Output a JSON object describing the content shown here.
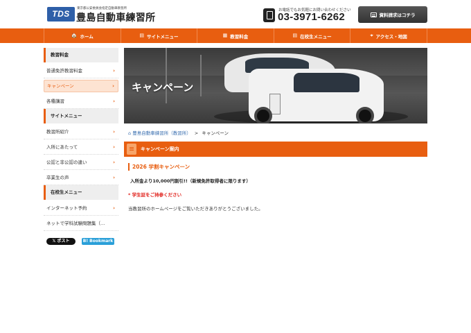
{
  "header": {
    "logo_badge": "TDS",
    "logo_subtitle": "東京都公安委員会指定自動車教習所",
    "logo_title": "豊島自動車練習所",
    "phone_note": "お電話でもお気軽にお問い合わせください",
    "phone_number": "03-3971-6262",
    "request_button": "資料請求はコチラ"
  },
  "nav": {
    "items": [
      {
        "icon": "🏠",
        "label": "ホーム"
      },
      {
        "icon": "▤",
        "label": "サイトメニュー"
      },
      {
        "icon": "▦",
        "label": "教習料金"
      },
      {
        "icon": "▤",
        "label": "在校生メニュー"
      },
      {
        "icon": "⌖",
        "label": "アクセス・地図"
      }
    ]
  },
  "sidebar": {
    "sections": [
      {
        "heading": "教習料金",
        "items": [
          "普通免許教習料金",
          "キャンペーン",
          "各種講習"
        ]
      },
      {
        "heading": "サイトメニュー",
        "items": [
          "教習所紹介",
          "入所にあたって",
          "公認と非公認の違い",
          "卒業生の声"
        ]
      },
      {
        "heading": "在校生メニュー",
        "items": [
          "インターネット予約",
          "ネットで学科試験問題集（…"
        ]
      }
    ],
    "active_item": "キャンペーン",
    "chevron": "›",
    "post_button": "𝕏 ポスト",
    "bookmark_button": "B! Bookmark"
  },
  "main": {
    "hero_title": "キャンペーン",
    "breadcrumb": {
      "home": "豊島自動車練習所（教習所）",
      "separator": ">",
      "current": "キャンペーン"
    },
    "section_title": "キャンペーン案内",
    "campaign_heading": "2026 学割キャンペーン",
    "offer_text": "入所金より10,000円割引!!（新規免許取得者に限ります）",
    "notice_text": "* 学生証をご持参ください",
    "thanks_text": "当教習所のホームページをご覧いただきありがとうございました。"
  },
  "colors": {
    "accent": "#e85e10",
    "logo_blue": "#2e5fa8",
    "link_blue": "#3a6fb0",
    "notice_red": "#e0201a"
  }
}
